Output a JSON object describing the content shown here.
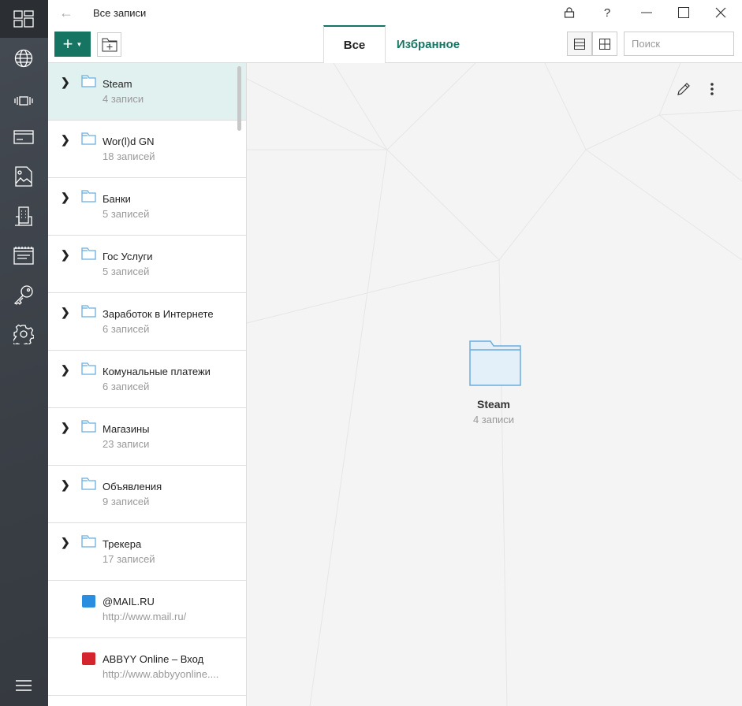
{
  "window": {
    "title": "Все записи",
    "back_icon": "arrow-left-icon"
  },
  "toolbar": {
    "add_icon": "plus-icon",
    "new_folder_icon": "folder-plus-icon"
  },
  "tabs": [
    {
      "label": "Все",
      "active": true
    },
    {
      "label": "Избранное",
      "active": false
    }
  ],
  "search": {
    "placeholder": "Поиск",
    "value": ""
  },
  "accent": "#157562",
  "list": [
    {
      "type": "folder",
      "name": "Steam",
      "sub": "4 записи",
      "selected": true
    },
    {
      "type": "folder",
      "name": "Wor(l)d GN",
      "sub": "18 записей"
    },
    {
      "type": "folder",
      "name": "Банки",
      "sub": "5 записей"
    },
    {
      "type": "folder",
      "name": "Гос Услуги",
      "sub": "5 записей"
    },
    {
      "type": "folder",
      "name": "Заработок в Интернете",
      "sub": "6 записей"
    },
    {
      "type": "folder",
      "name": "Комунальные платежи",
      "sub": "6 записей"
    },
    {
      "type": "folder",
      "name": "Магазины",
      "sub": "23 записи"
    },
    {
      "type": "folder",
      "name": "Объявления",
      "sub": "9 записей"
    },
    {
      "type": "folder",
      "name": "Трекера",
      "sub": "17 записей"
    },
    {
      "type": "site",
      "name": "@MAIL.RU",
      "sub": "http://www.mail.ru/",
      "color": "#2a8de0"
    },
    {
      "type": "site",
      "name": "ABBYY Online – Вход",
      "sub": "http://www.abbyyonline....",
      "color": "#d4252f"
    }
  ],
  "detail": {
    "name": "Steam",
    "sub": "4 записи"
  }
}
